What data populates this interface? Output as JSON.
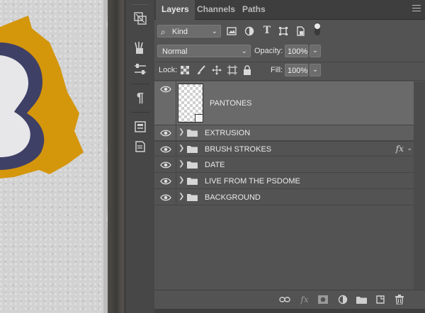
{
  "panel": {
    "tabs": [
      {
        "label": "Layers",
        "active": true
      },
      {
        "label": "Channels",
        "active": false
      },
      {
        "label": "Paths",
        "active": false
      }
    ],
    "filter": {
      "value": "Kind"
    },
    "blend_mode": {
      "value": "Normal"
    },
    "opacity": {
      "label": "Opacity:",
      "value": "100%"
    },
    "lock": {
      "label": "Lock:"
    },
    "fill": {
      "label": "Fill:",
      "value": "100%"
    },
    "layers": [
      {
        "name": "PANTONES",
        "type": "smart-object",
        "visible": true,
        "selected": true
      },
      {
        "name": "EXTRUSION",
        "type": "group",
        "visible": true,
        "selected": true
      },
      {
        "name": "BRUSH STROKES",
        "type": "group",
        "visible": true,
        "selected": false,
        "fx": "fx"
      },
      {
        "name": "DATE",
        "type": "group",
        "visible": true,
        "selected": false
      },
      {
        "name": "LIVE FROM THE PSDOME",
        "type": "group",
        "visible": true,
        "selected": false
      },
      {
        "name": "BACKGROUND",
        "type": "group",
        "visible": true,
        "selected": false
      }
    ],
    "bottom_icons": [
      "link-icon",
      "fx-icon",
      "mask-icon",
      "adjustment-icon",
      "new-group-icon",
      "new-layer-icon",
      "trash-icon"
    ]
  },
  "toolstrip": {
    "icons": [
      "transform-icon",
      "brush-presets-icon",
      "adjustments-icon",
      "paragraph-icon",
      "properties-icon",
      "notes-icon"
    ]
  },
  "colors": {
    "panel_bg": "#535353",
    "tab_bar": "#3e3e3e",
    "selection": "#6a6a6a",
    "canvas_yellow": "#d4960b",
    "canvas_navy": "#3f4066"
  }
}
